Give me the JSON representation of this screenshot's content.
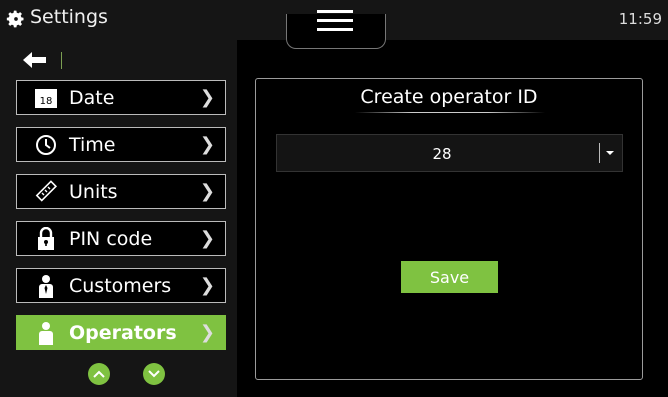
{
  "header": {
    "title": "Settings",
    "time": "11:59"
  },
  "sidebar": {
    "items": [
      {
        "label": "Date",
        "icon": "calendar-icon",
        "icon_text": "18"
      },
      {
        "label": "Time",
        "icon": "clock-icon"
      },
      {
        "label": "Units",
        "icon": "ruler-icon"
      },
      {
        "label": "PIN code",
        "icon": "lock-icon"
      },
      {
        "label": "Customers",
        "icon": "person-icon"
      },
      {
        "label": "Operators",
        "icon": "person-icon",
        "active": true
      }
    ]
  },
  "main": {
    "title": "Create operator ID",
    "operator_id_value": "28",
    "save_label": "Save"
  },
  "colors": {
    "accent": "#7fc241",
    "background": "#000000",
    "panel_border": "#9b9b9b"
  }
}
